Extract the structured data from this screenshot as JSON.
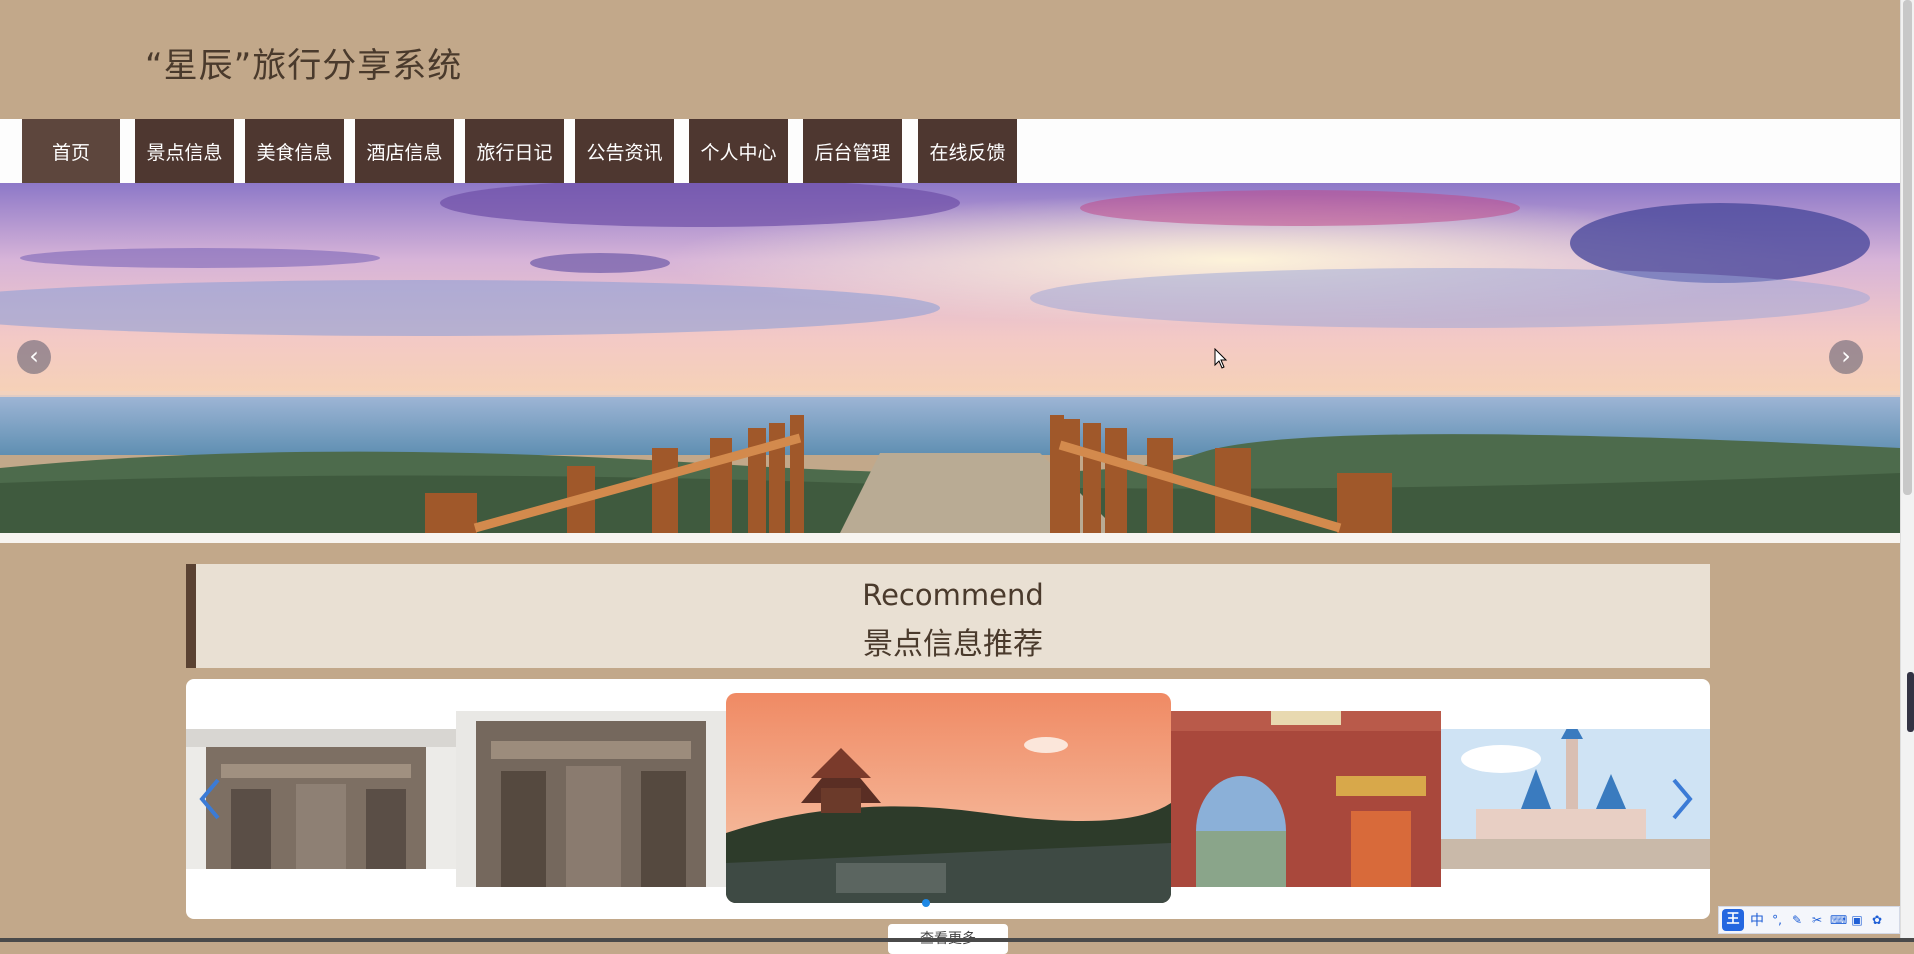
{
  "header": {
    "title": "“星辰”旅行分享系统"
  },
  "nav": {
    "items": [
      "首页",
      "景点信息",
      "美食信息",
      "酒店信息",
      "旅行日记",
      "公告资讯",
      "个人中心",
      "后台管理",
      "在线反馈"
    ],
    "active_index": 0
  },
  "banner": {
    "prev_icon": "chevron-left-icon",
    "next_icon": "chevron-right-icon"
  },
  "recommend": {
    "title_en": "Recommend",
    "title_cn": "景点信息推荐"
  },
  "carousel": {
    "prev_icon": "chevron-left-icon",
    "next_icon": "chevron-right-icon"
  },
  "more": {
    "label": "查看更多"
  },
  "ime": {
    "logo": "王",
    "mode": "中"
  },
  "colors": {
    "background": "#c2a88a",
    "nav": "#4e3730",
    "accent": "#1e88e5"
  }
}
